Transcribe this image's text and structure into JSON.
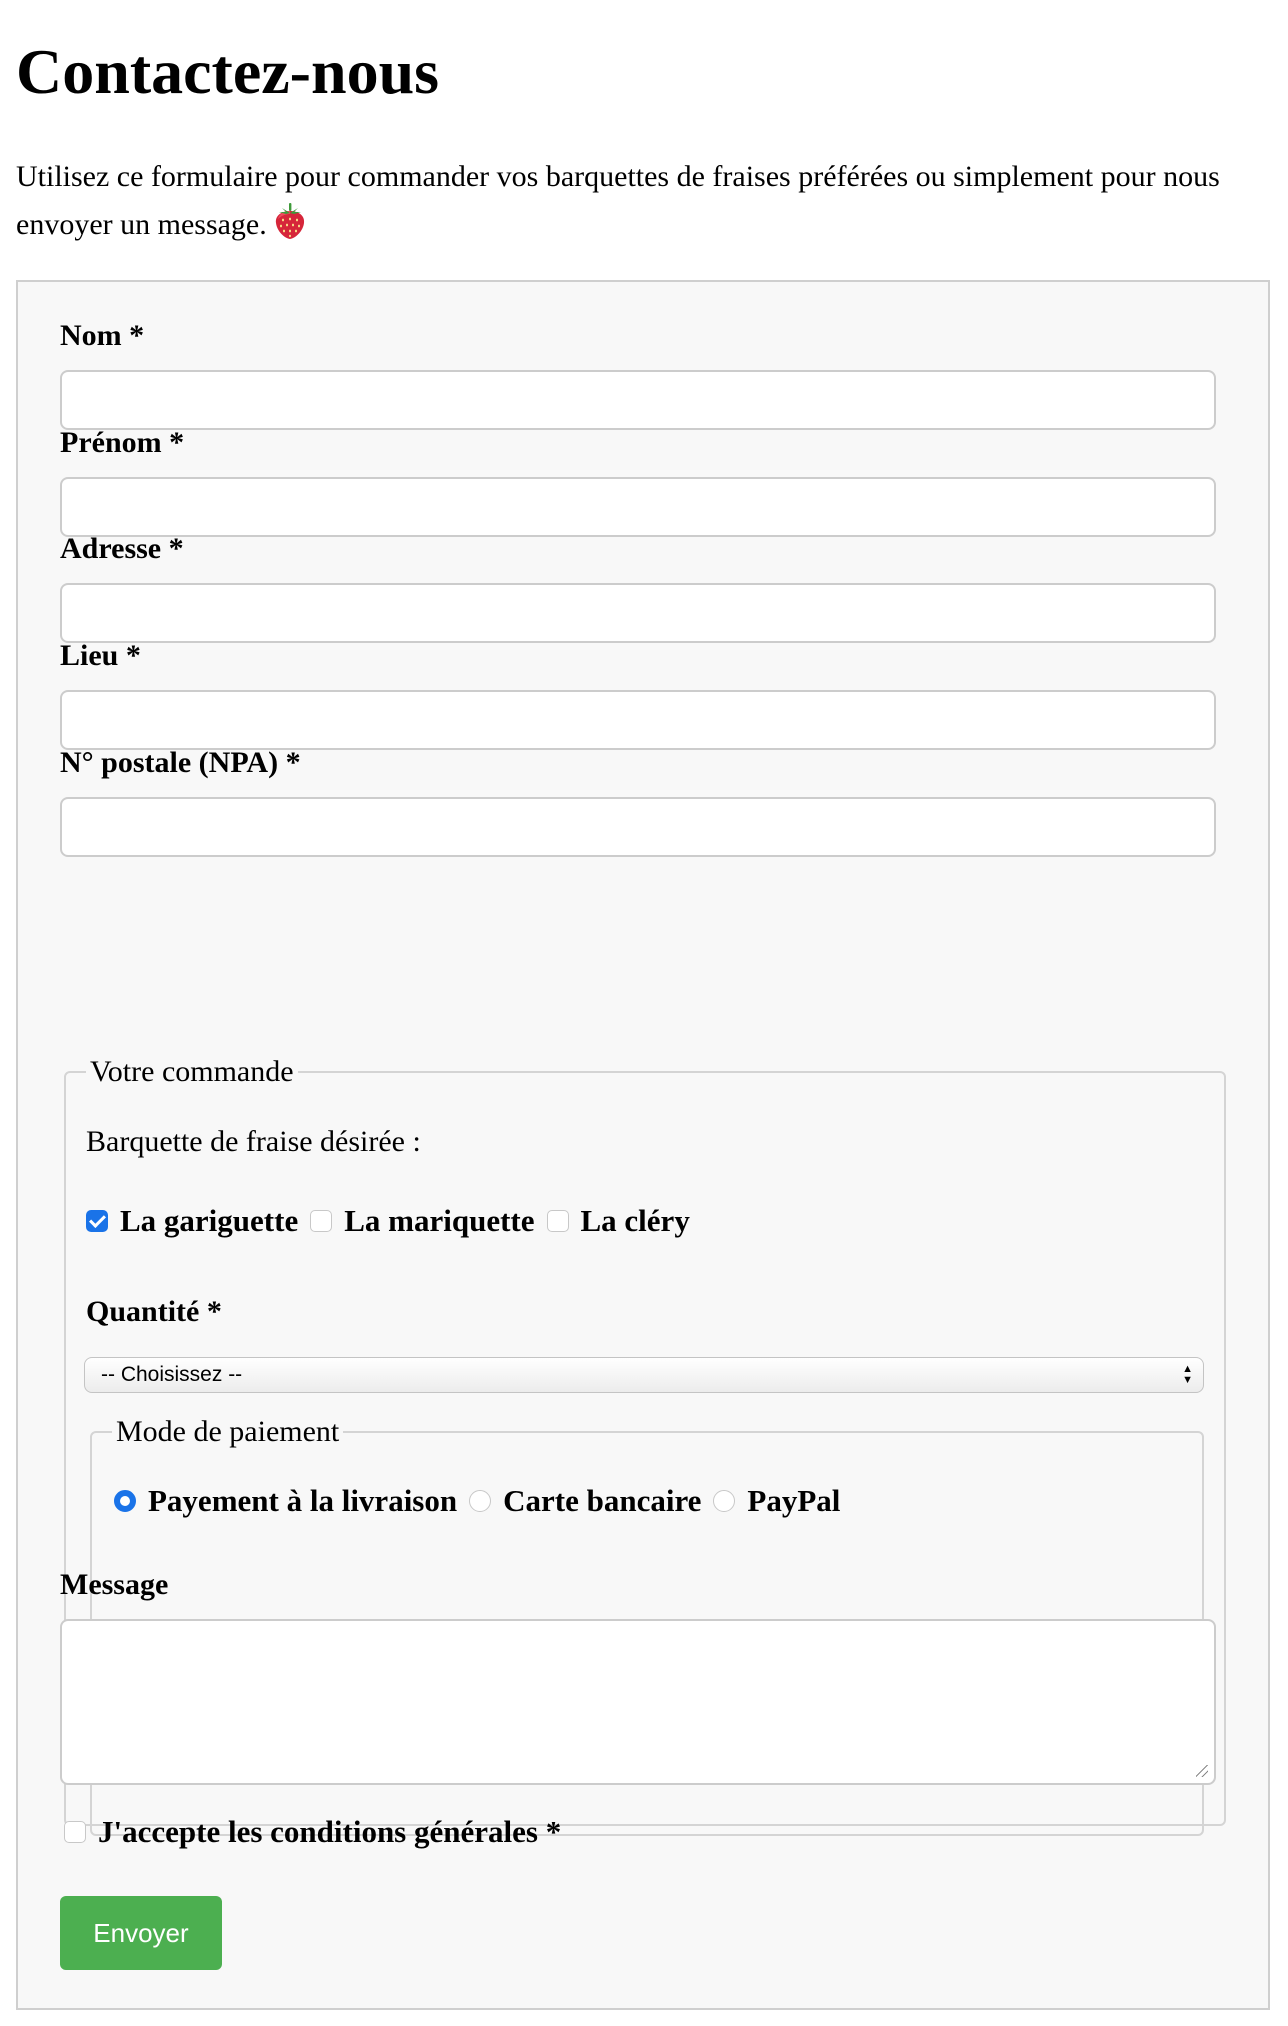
{
  "page": {
    "title": "Contactez-nous",
    "intro": "Utilisez ce formulaire pour commander vos barquettes de fraises préférées ou simplement pour nous envoyer un message."
  },
  "form": {
    "fields": {
      "nom": {
        "label": "Nom *",
        "value": ""
      },
      "prenom": {
        "label": "Prénom *",
        "value": ""
      },
      "adresse": {
        "label": "Adresse *",
        "value": ""
      },
      "lieu": {
        "label": "Lieu *",
        "value": ""
      },
      "npa": {
        "label": "N° postale (NPA) *",
        "value": ""
      }
    },
    "order": {
      "legend": "Votre commande",
      "tray_label": "Barquette de fraise désirée :",
      "trays": [
        {
          "label": "La gariguette",
          "checked": true
        },
        {
          "label": "La mariquette",
          "checked": false
        },
        {
          "label": "La cléry",
          "checked": false
        }
      ],
      "quantity_label": "Quantité *",
      "quantity_selected": "-- Choisissez --",
      "payment": {
        "legend": "Mode de paiement",
        "options": [
          {
            "label": "Payement à la livraison",
            "selected": true
          },
          {
            "label": "Carte bancaire",
            "selected": false
          },
          {
            "label": "PayPal",
            "selected": false
          }
        ]
      }
    },
    "message": {
      "label": "Message",
      "value": ""
    },
    "accept": {
      "label": "J'accepte les conditions générales *",
      "checked": false
    },
    "submit_label": "Envoyer"
  },
  "icons": {
    "intro_icon": "strawberry-icon"
  },
  "colors": {
    "accent": "#1a73e8",
    "submit_button": "#4caf50",
    "form_background": "#f8f8f8"
  }
}
